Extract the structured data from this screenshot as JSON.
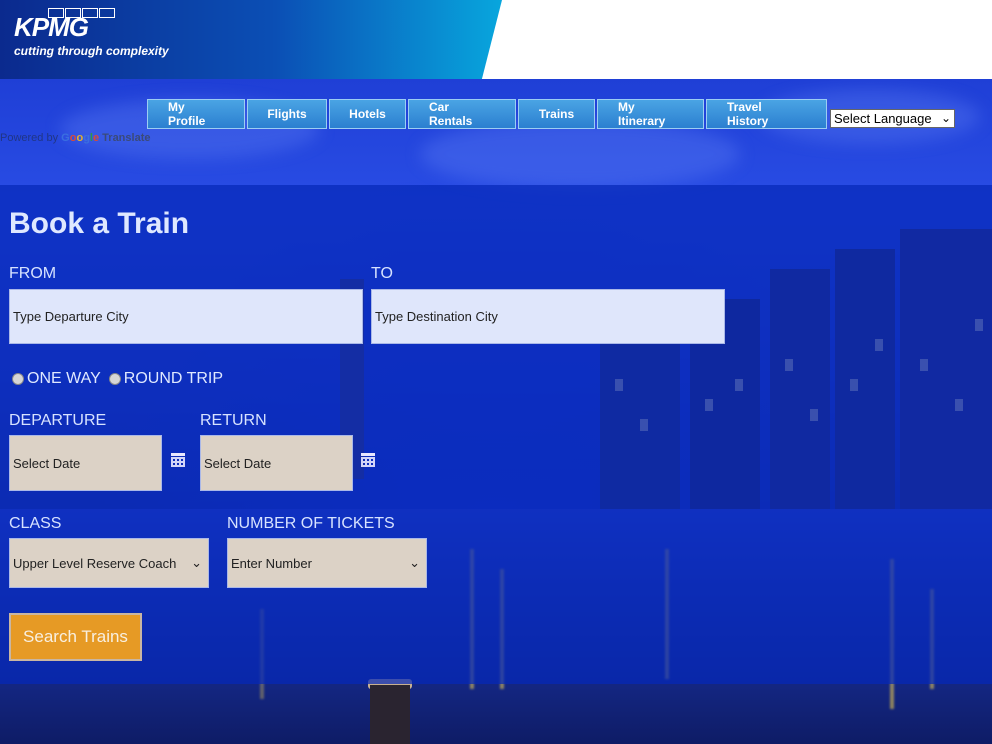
{
  "header": {
    "logo_text": "KPMG",
    "tagline": "cutting through complexity"
  },
  "nav": {
    "items": [
      {
        "label": "My Profile"
      },
      {
        "label": "Flights"
      },
      {
        "label": "Hotels"
      },
      {
        "label": "Car Rentals"
      },
      {
        "label": "Trains"
      },
      {
        "label": "My Itinerary"
      },
      {
        "label": "Travel History"
      }
    ],
    "language_select": "Select Language",
    "powered_by": "Powered by",
    "google": [
      "G",
      "o",
      "o",
      "g",
      "l",
      "e"
    ],
    "translate": "Translate"
  },
  "booking": {
    "title": "Book a Train",
    "from_label": "FROM",
    "from_placeholder": "Type Departure City",
    "to_label": "TO",
    "to_placeholder": "Type Destination City",
    "one_way": "ONE WAY",
    "round_trip": "ROUND TRIP",
    "departure_label": "DEPARTURE",
    "departure_placeholder": "Select Date",
    "return_label": "RETURN",
    "return_placeholder": "Select Date",
    "class_label": "CLASS",
    "class_value": "Upper Level Reserve Coach",
    "tickets_label": "NUMBER OF TICKETS",
    "tickets_value": "Enter Number",
    "search_label": "Search Trains"
  },
  "colors": {
    "nav_bg": "#2b7fd0",
    "panel_bg": "#0628b9",
    "button_bg": "#e69a25"
  }
}
